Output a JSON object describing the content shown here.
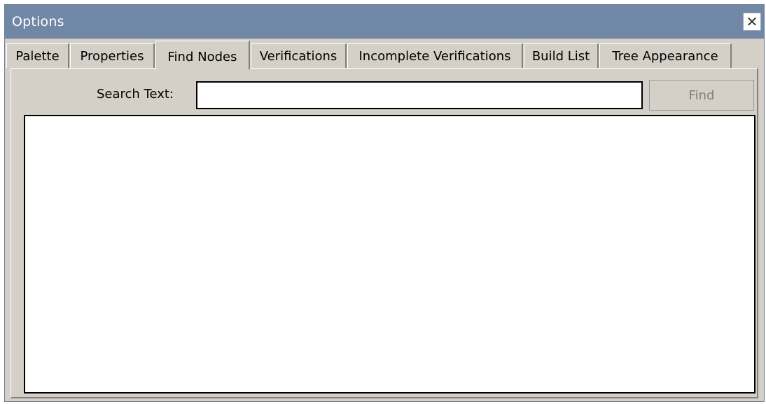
{
  "window": {
    "title": "Options",
    "close_symbol": "✕"
  },
  "tabs": [
    {
      "label": "Palette",
      "active": false
    },
    {
      "label": "Properties",
      "active": false
    },
    {
      "label": "Find Nodes",
      "active": true
    },
    {
      "label": "Verifications",
      "active": false
    },
    {
      "label": "Incomplete Verifications",
      "active": false
    },
    {
      "label": "Build List",
      "active": false
    },
    {
      "label": "Tree Appearance",
      "active": false
    }
  ],
  "find_nodes": {
    "search_label": "Search Text:",
    "search_value": "",
    "find_button_label": "Find",
    "results": []
  },
  "colors": {
    "titlebar": "#7087a6",
    "dialog_background": "#d4d0c8",
    "disabled_text": "#808080"
  },
  "icons": {
    "close": "close-icon"
  }
}
